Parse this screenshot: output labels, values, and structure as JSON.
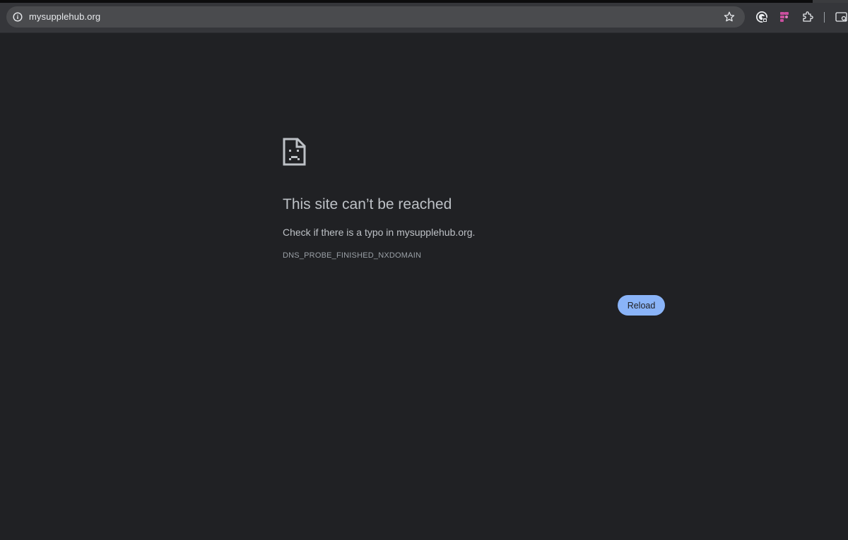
{
  "browser": {
    "url": "mysupplehub.org",
    "icons": {
      "site_info": "info-icon",
      "bookmark": "star-icon",
      "profile": "google-account-icon",
      "extension": "figma-extension-icon",
      "extensions_menu": "puzzle-icon",
      "search_tabs": "tab-search-icon"
    }
  },
  "error_page": {
    "icon": "sad-document-icon",
    "title": "This site can’t be reached",
    "description": "Check if there is a typo in mysupplehub.org.",
    "error_code": "DNS_PROBE_FINISHED_NXDOMAIN",
    "reload_label": "Reload"
  },
  "colors": {
    "background": "#202124",
    "toolbar": "#35363a",
    "omnibox": "#4a4b4e",
    "accent_button": "#8ab4f8",
    "text_primary": "#bdc1c6",
    "text_secondary": "#9aa0a6"
  }
}
